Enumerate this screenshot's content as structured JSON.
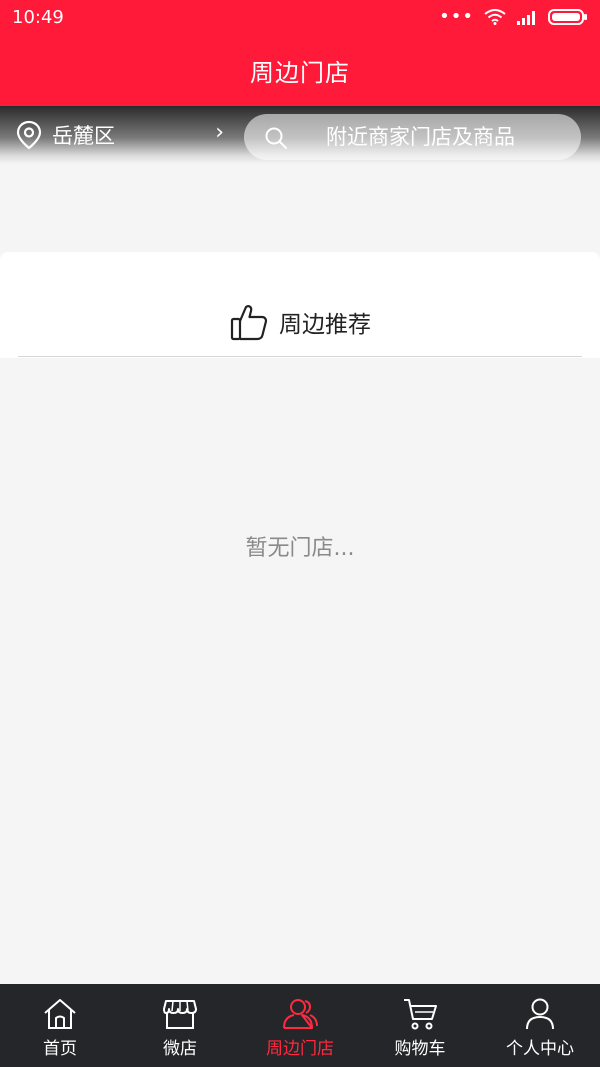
{
  "status_bar": {
    "time": "10:49",
    "dots": "•••"
  },
  "header": {
    "title": "周边门店"
  },
  "location": {
    "label": "岳麓区",
    "chevron": "›"
  },
  "search": {
    "placeholder": "附近商家门店及商品"
  },
  "recommend": {
    "title": "周边推荐",
    "empty_text": "暂无门店..."
  },
  "bottom_nav": {
    "items": [
      {
        "label": "首页",
        "icon": "home-icon"
      },
      {
        "label": "微店",
        "icon": "store-icon"
      },
      {
        "label": "周边门店",
        "icon": "nearby-users-icon"
      },
      {
        "label": "购物车",
        "icon": "cart-icon"
      },
      {
        "label": "个人中心",
        "icon": "person-icon"
      }
    ],
    "active_index": 2
  },
  "colors": {
    "brand_red": "#ff1a3a",
    "nav_bg": "#25262a",
    "nav_active": "#ff2a3f",
    "page_bg": "#f5f5f5"
  }
}
